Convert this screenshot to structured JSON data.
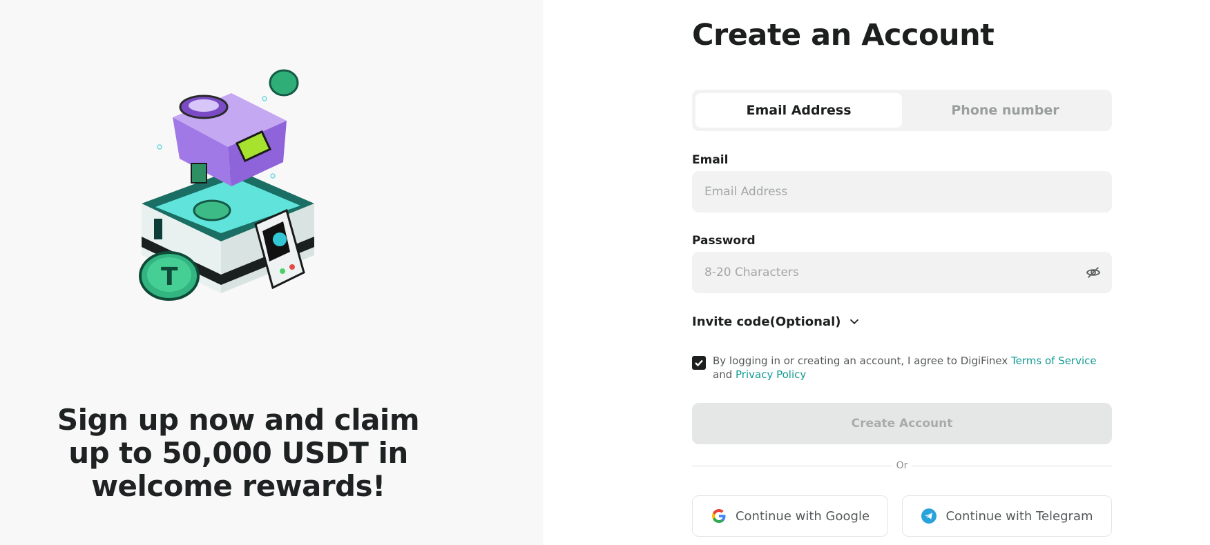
{
  "promo": {
    "headline": "Sign up now and claim up to 50,000 USDT in welcome rewards!"
  },
  "form": {
    "title": "Create an Account",
    "tabs": [
      {
        "label": "Email Address",
        "active": true
      },
      {
        "label": "Phone number",
        "active": false
      }
    ],
    "email": {
      "label": "Email",
      "placeholder": "Email Address",
      "value": ""
    },
    "password": {
      "label": "Password",
      "placeholder": "8-20 Characters",
      "value": ""
    },
    "invite": {
      "label": "Invite code(Optional)"
    },
    "agreement": {
      "checked": true,
      "text": "By logging in or creating an account, I agree to DigiFinex",
      "terms_link": "Terms of Service",
      "and": "and",
      "privacy_link": "Privacy Policy"
    },
    "create_button": "Create Account",
    "divider": "Or",
    "google_button": "Continue with Google",
    "telegram_button": "Continue with Telegram"
  },
  "icons": {
    "password_toggle": "eye-slash-icon",
    "invite_toggle": "chevron-down-icon",
    "checkbox": "check-icon",
    "google": "google-icon",
    "telegram": "telegram-icon"
  },
  "colors": {
    "accent_link": "#109a92",
    "left_panel_bg": "#f8f8f8",
    "input_bg": "#f2f2f2",
    "disabled_button_bg": "#e5e7e7"
  }
}
